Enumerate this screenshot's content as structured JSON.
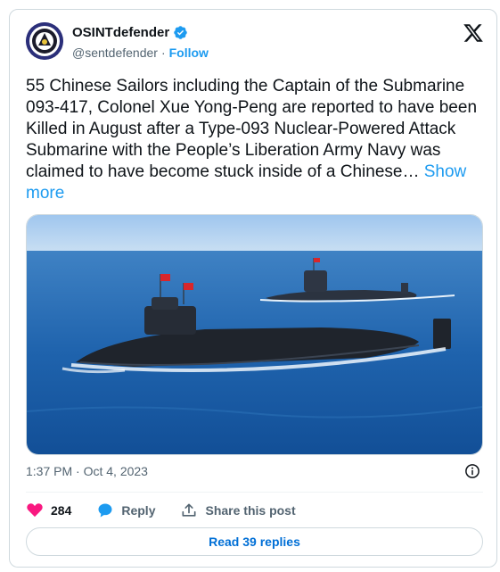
{
  "author": {
    "display_name": "OSINTdefender",
    "handle": "@sentdefender",
    "separator": "·",
    "follow_label": "Follow"
  },
  "tweet": {
    "text": "55 Chinese Sailors including the Captain of the Submarine 093-417, Colonel Xue Yong-Peng are reported to have been Killed in August after a Type-093 Nuclear-Powered Attack Submarine with the People’s Liberation Army Navy was claimed to have become stuck inside of a Chinese…",
    "show_more_label": "Show more",
    "timestamp": "1:37 PM · Oct 4, 2023"
  },
  "actions": {
    "like_count": "284",
    "reply_label": "Reply",
    "share_label": "Share this post"
  },
  "replies_button_label": "Read 39 replies",
  "colors": {
    "accent": "#1d9bf0",
    "like": "#f91880",
    "muted": "#536471"
  }
}
